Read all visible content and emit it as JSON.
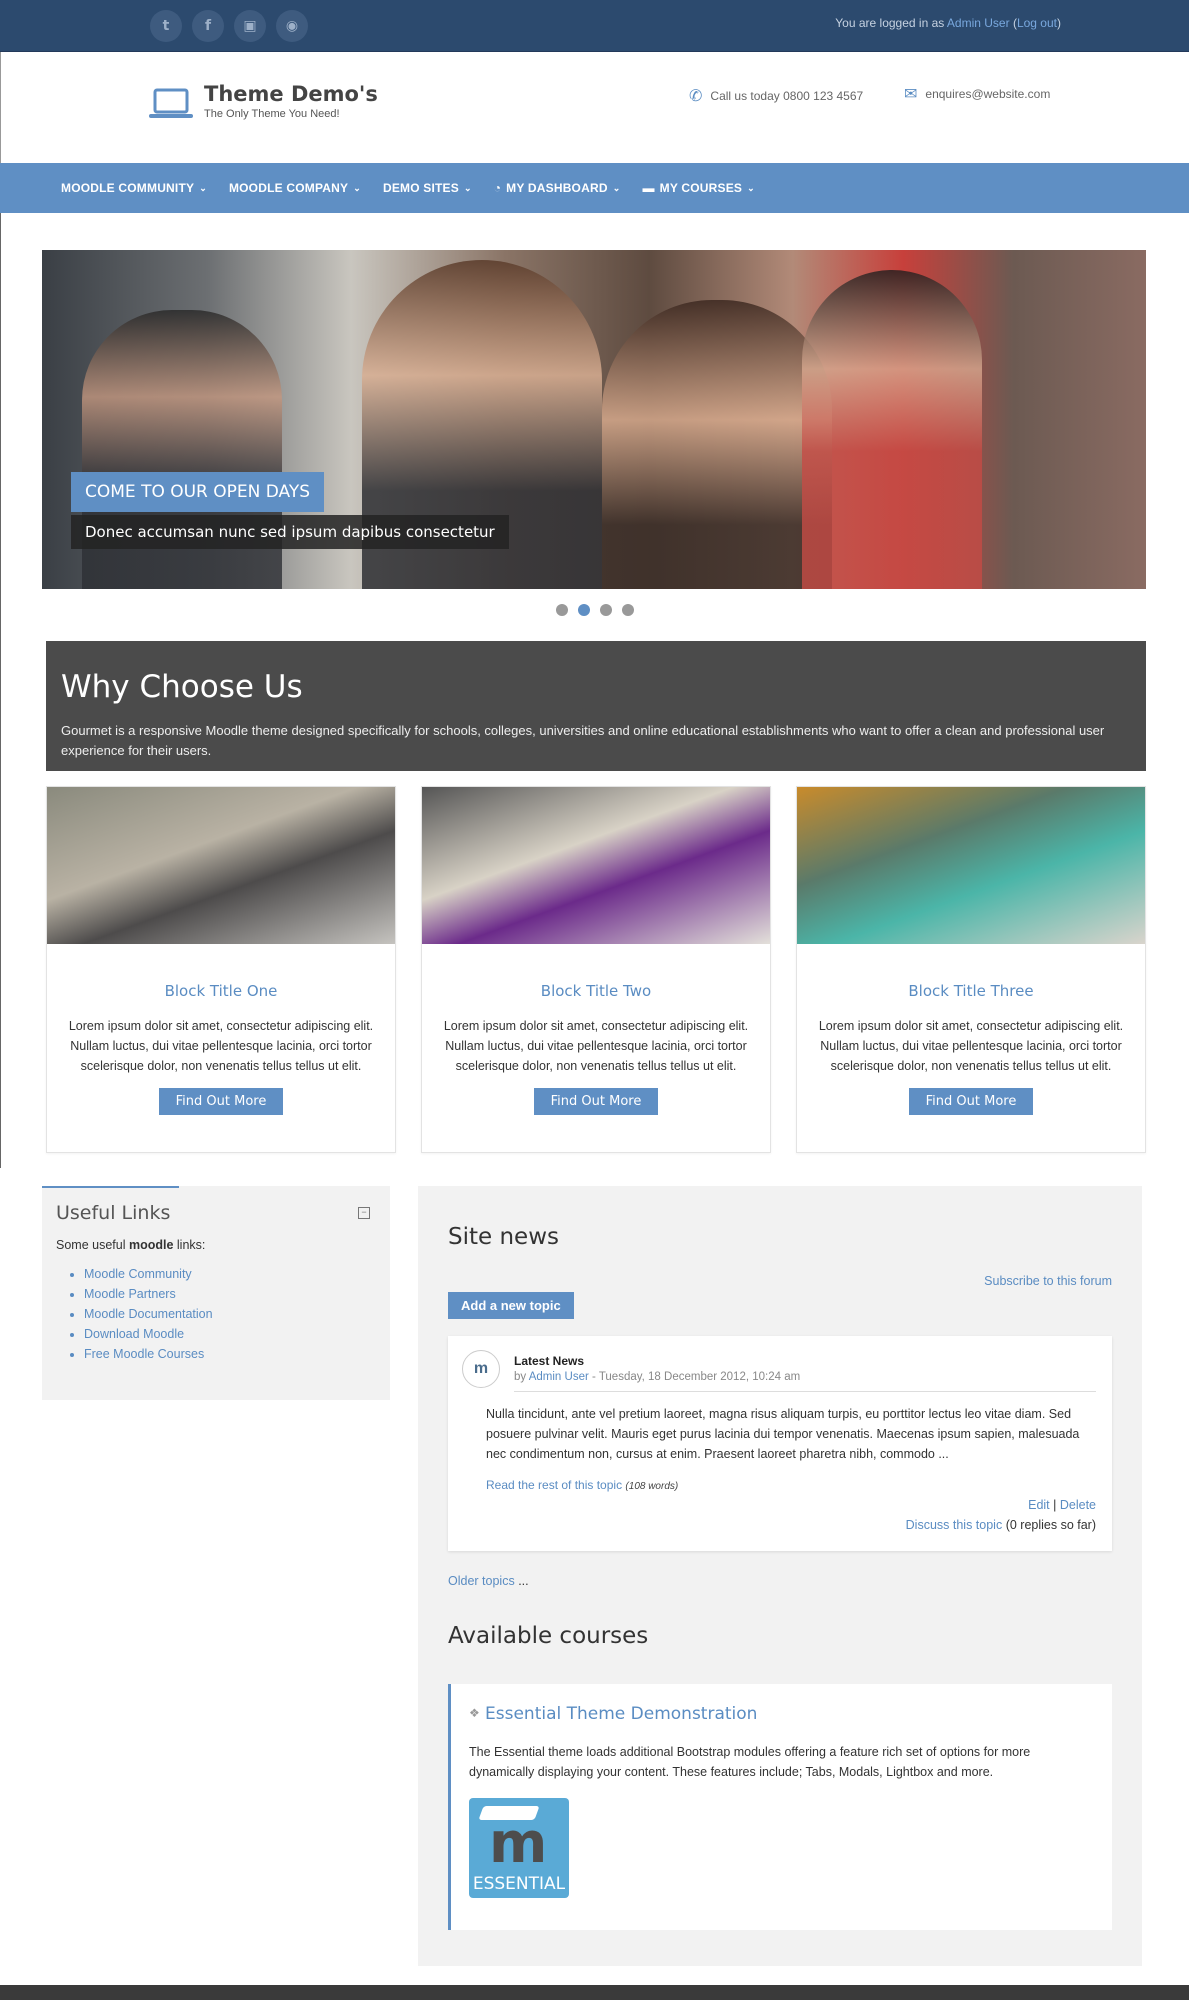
{
  "topbar": {
    "social_icons": [
      "twitter-icon",
      "facebook-icon",
      "flickr-icon",
      "globe-icon"
    ],
    "login_prefix": "You are logged in as",
    "user_name": "Admin User",
    "logout_label": "Log out"
  },
  "header": {
    "title": "Theme Demo's",
    "subtitle": "The Only Theme You Need!",
    "phone": "Call us today 0800 123 4567",
    "email": "enquires@website.com"
  },
  "nav": {
    "items": [
      {
        "label": "MOODLE COMMUNITY",
        "icon": ""
      },
      {
        "label": "MOODLE COMPANY",
        "icon": ""
      },
      {
        "label": "DEMO SITES",
        "icon": ""
      },
      {
        "label": "MY DASHBOARD",
        "icon": "dashboard-icon"
      },
      {
        "label": "MY COURSES",
        "icon": "briefcase-icon"
      }
    ]
  },
  "slider": {
    "caption_title": "COME TO OUR OPEN DAYS",
    "caption_text": "Donec accumsan nunc sed ipsum dapibus consectetur",
    "slide_count": 4,
    "active_slide": 2
  },
  "why": {
    "title": "Why Choose Us",
    "text": "Gourmet is a responsive Moodle theme designed specifically for schools, colleges, universities and online educational establishments who want to offer a clean and professional user experience for their users."
  },
  "blocks": [
    {
      "title": "Block Title One",
      "text": "Lorem ipsum dolor sit amet, consectetur adipiscing elit. Nullam luctus, dui vitae pellentesque lacinia, orci tortor scelerisque dolor, non venenatis tellus tellus ut elit.",
      "button": "Find Out More"
    },
    {
      "title": "Block Title Two",
      "text": "Lorem ipsum dolor sit amet, consectetur adipiscing elit. Nullam luctus, dui vitae pellentesque lacinia, orci tortor scelerisque dolor, non venenatis tellus tellus ut elit.",
      "button": "Find Out More"
    },
    {
      "title": "Block Title Three",
      "text": "Lorem ipsum dolor sit amet, consectetur adipiscing elit. Nullam luctus, dui vitae pellentesque lacinia, orci tortor scelerisque dolor, non venenatis tellus tellus ut elit.",
      "button": "Find Out More"
    }
  ],
  "useful_links": {
    "title": "Useful Links",
    "intro_prefix": "Some useful",
    "intro_bold": "moodle",
    "intro_suffix": "links:",
    "links": [
      "Moodle Community",
      "Moodle Partners",
      "Moodle Documentation",
      "Download Moodle",
      "Free Moodle Courses"
    ]
  },
  "site_news": {
    "title": "Site news",
    "subscribe": "Subscribe to this forum",
    "add_topic": "Add a new topic",
    "post": {
      "title": "Latest News",
      "by_prefix": "by",
      "author": "Admin User",
      "date": "- Tuesday, 18 December 2012, 10:24 am",
      "body": "Nulla tincidunt, ante vel pretium laoreet, magna risus aliquam turpis, eu porttitor lectus leo vitae diam. Sed posuere pulvinar velit. Mauris eget purus lacinia dui tempor venenatis. Maecenas ipsum sapien, malesuada nec condimentum non, cursus at enim. Praesent laoreet pharetra nibh, commodo ...",
      "read_more": "Read the rest of this topic",
      "word_count": "(108 words)",
      "edit": "Edit",
      "delete": "Delete",
      "discuss": "Discuss this topic",
      "replies": "(0 replies so far)"
    },
    "older_topics": "Older topics",
    "older_suffix": "..."
  },
  "available_courses": {
    "title": "Available courses",
    "course": {
      "name": "Essential Theme Demonstration",
      "description": "The Essential theme loads additional Bootstrap modules offering a feature rich set of options for more dynamically displaying your content. These features include; Tabs, Modals, Lightbox and more.",
      "logo_text": "ESSENTIAL"
    }
  },
  "colors": {
    "topbar": "#2c4a6e",
    "accent": "#5f8fc4",
    "why_bg": "#4b4b4b"
  }
}
